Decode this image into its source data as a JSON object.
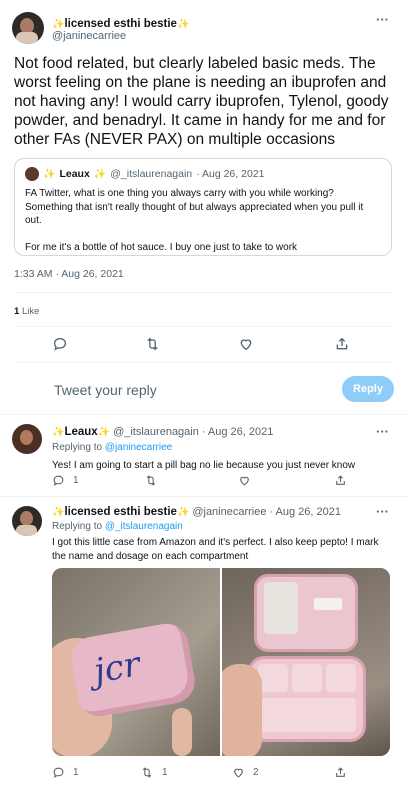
{
  "main_tweet": {
    "display_name": "licensed esthi bestie",
    "handle": "@janinecarriee",
    "text": "Not food related, but clearly labeled basic meds. The worst feeling on the plane is needing an ibuprofen and not having any! I would carry ibuprofen, Tylenol, goody powder, and benadryl. It came in handy for me and for other FAs (NEVER PAX) on multiple occasions",
    "quoted": {
      "display_name": "Leaux",
      "handle": "@_itslaurenagain",
      "date": "· Aug 26, 2021",
      "text_1": "FA Twitter, what is one thing you always carry with you while working? Something that isn't really thought of but always appreciated when you pull it out.",
      "text_2": "For me it's a bottle of hot sauce. I buy one just to take to work"
    },
    "timestamp": "1:33 AM · Aug 26, 2021",
    "like_count": "1",
    "like_label": "Like"
  },
  "reply_box": {
    "placeholder": "Tweet your reply",
    "button_label": "Reply"
  },
  "reply_1": {
    "display_name": "Leaux",
    "handle": "@_itslaurenagain",
    "date": "· Aug 26, 2021",
    "replying_label": "Replying to",
    "replying_to": "@janinecarriee",
    "text": "Yes! I am going to start a pill bag no lie because you just never know",
    "reply_count": "1"
  },
  "reply_2": {
    "display_name": "licensed esthi bestie",
    "handle": "@janinecarriee",
    "date": "· Aug 26, 2021",
    "replying_label": "Replying to",
    "replying_to": "@_itslaurenagain",
    "text": "I got this little case from Amazon and it's perfect. I also keep pepto! I mark the name and dosage on each compartment",
    "reply_count": "1",
    "retweet_count": "1",
    "like_count": "2",
    "case_lettering": "jcr"
  },
  "icons": {
    "more": "more-icon",
    "reply": "reply-icon",
    "retweet": "retweet-icon",
    "like": "heart-icon",
    "share": "share-icon"
  },
  "colors": {
    "accent": "#1d9bf0",
    "reply_button": "#8ecdf8",
    "muted": "#536471",
    "border": "#cfd9de"
  }
}
